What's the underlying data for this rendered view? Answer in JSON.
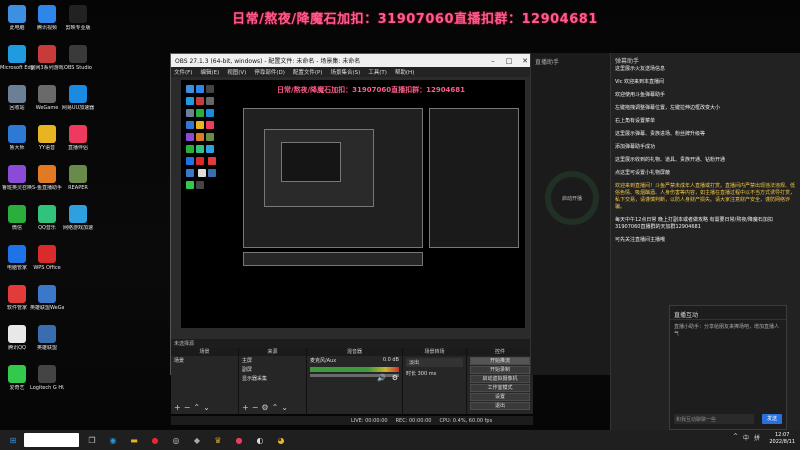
{
  "banner": "日常/熬夜/降魔石加扣：31907060直播扣群：12904681",
  "desktop_icons_col1": [
    {
      "label": "此电脑",
      "icon": "computer-icon",
      "color": "#3d8fe0"
    },
    {
      "label": "Microsoft Edge",
      "icon": "edge-icon",
      "color": "#1f9be0"
    },
    {
      "label": "回收站",
      "icon": "recycle-bin-icon",
      "color": "#6b7f96"
    },
    {
      "label": "鲁大师",
      "icon": "ludashi-icon",
      "color": "#2c7ad6"
    },
    {
      "label": "鲁班英灵召唤",
      "icon": "app-icon",
      "color": "#8a4bd6"
    },
    {
      "label": "微信",
      "icon": "wechat-icon",
      "color": "#2aae3c"
    },
    {
      "label": "电脑管家",
      "icon": "pc-manager-icon",
      "color": "#1e73e8"
    },
    {
      "label": "软件管家",
      "icon": "software-icon",
      "color": "#e33a3a"
    },
    {
      "label": "腾讯QQ",
      "icon": "qq-icon",
      "color": "#e8e8e8"
    },
    {
      "label": "爱奇艺",
      "icon": "iqiyi-icon",
      "color": "#32c94c"
    }
  ],
  "desktop_icons_col2": [
    {
      "label": "腾讯视频",
      "icon": "tencent-video-icon",
      "color": "#2e86e8"
    },
    {
      "label": "剑网3系列游戏",
      "icon": "game-icon",
      "color": "#c73b3b"
    },
    {
      "label": "WeGame",
      "icon": "wegame-icon",
      "color": "#6a6a6a"
    },
    {
      "label": "YY语音",
      "icon": "yy-icon",
      "color": "#e7b422"
    },
    {
      "label": "S-鱼直播助手",
      "icon": "live-helper-icon",
      "color": "#e07b24"
    },
    {
      "label": "QQ音乐",
      "icon": "qq-music-icon",
      "color": "#31c27c"
    },
    {
      "label": "WPS Office",
      "icon": "wps-icon",
      "color": "#d92b2b"
    },
    {
      "label": "英雄联盟WeGame版",
      "icon": "lol-icon",
      "color": "#3b78c9"
    },
    {
      "label": "英雄联盟",
      "icon": "lol-icon",
      "color": "#3a6db0"
    },
    {
      "label": "Logitech G HUB",
      "icon": "logitech-icon",
      "color": "#444444"
    }
  ],
  "desktop_icons_col3": [
    {
      "label": "剪映专业版",
      "icon": "capcut-icon",
      "color": "#222222"
    },
    {
      "label": "OBS Studio",
      "icon": "obs-icon",
      "color": "#3a3a3a"
    },
    {
      "label": "网易UU加速器",
      "icon": "uu-icon",
      "color": "#1a8be0"
    },
    {
      "label": "直播伴侣",
      "icon": "live-companion-icon",
      "color": "#ee3a5e"
    },
    {
      "label": "REAPER",
      "icon": "reaper-icon",
      "color": "#6a8a4a"
    },
    {
      "label": "网络游戏加速",
      "icon": "booster-icon",
      "color": "#2ea0e0"
    }
  ],
  "obs": {
    "title": "OBS 27.1.3 (64-bit, windows) - 配置文件: 未命名 - 场景集: 未命名",
    "menu": [
      "文件(F)",
      "编辑(E)",
      "视图(V)",
      "停靠部件(D)",
      "配置文件(P)",
      "场景集合(S)",
      "工具(T)",
      "帮助(H)"
    ],
    "preview_banner": "日常/熬夜/降魔石加扣：31907060直播扣群：12904681",
    "selected_source_bar": "未选择源",
    "docks": {
      "scenes": {
        "title": "场景",
        "items": [
          "场景"
        ]
      },
      "sources": {
        "title": "来源",
        "items": [
          "主屏",
          "副屏",
          "显示器采集"
        ]
      },
      "mixer": {
        "title": "混音器",
        "items": [
          "麦克风/Aux"
        ],
        "level": "0.0 dB"
      },
      "transitions": {
        "title": "场景转场",
        "items": [
          "淡出",
          "时长 300 ms"
        ]
      },
      "controls": {
        "title": "控件",
        "buttons": [
          "开始推流",
          "开始录制",
          "启动虚拟摄像机",
          "工作室模式",
          "设置",
          "退出"
        ]
      }
    },
    "status": [
      "LIVE: 00:00:00",
      "REC: 00:00:00",
      "CPU: 0.4%, 60.00 fps"
    ]
  },
  "live_panel": {
    "header": "直播助手",
    "ring_label": "启动开播"
  },
  "chat": {
    "header": "弹幕助手",
    "messages": [
      {
        "text": "这里展示火友送场信息",
        "color": "white"
      },
      {
        "text": "Vic 欢迎来到本直播间",
        "color": "white"
      },
      {
        "text": "欢迎使用斗鱼弹幕助手",
        "color": "white"
      },
      {
        "text": "左键拖拽调整弹幕位置，左键拉伸边框改变大小",
        "color": "white"
      },
      {
        "text": "右上角有设置菜单",
        "color": "white"
      },
      {
        "text": "这里展示弹幕、贵族进场、粉丝牌升级等",
        "color": "white"
      },
      {
        "text": "添加弹幕助手成功",
        "color": "white"
      },
      {
        "text": "这里展示收到的礼物、道具、贵族开通、钻粉开通",
        "color": "white"
      },
      {
        "text": "点这里可设置小礼物屏蔽",
        "color": "white"
      },
      {
        "text": "欢迎来到直播间！斗鱼严禁未成年人直播或打赏。直播间内严禁出现违法违规、低俗色情、吸烟酗酒、人身伤害等内容，如主播在直播过程中以不当方式诱导打赏，私下交易，请谨慎判断，以防人身财产损失。请大家注意财产安全，谨防网络诈骗。",
        "color": "yellow"
      },
      {
        "text": "每天中午12点日常 晚上打副本或者做攻略 有需要日常/熬夜/降魔石加扣31907060直播群的天加群12904681",
        "color": "white"
      },
      {
        "text": "可先关注直播间主播哦",
        "color": "white"
      }
    ]
  },
  "dialog": {
    "title": "直播互动",
    "body": "直播小助手：分享给朋友来捧场吧，增加直播人气",
    "input_placeholder": "和我互动聊聊一些",
    "send": "发送"
  },
  "taskbar": {
    "tray": [
      "^",
      "中",
      "拼"
    ],
    "time": "12:07",
    "date": "2022/8/11"
  },
  "colors": {
    "banner": "#ff5c8a",
    "send_button": "#2a6fdb"
  }
}
